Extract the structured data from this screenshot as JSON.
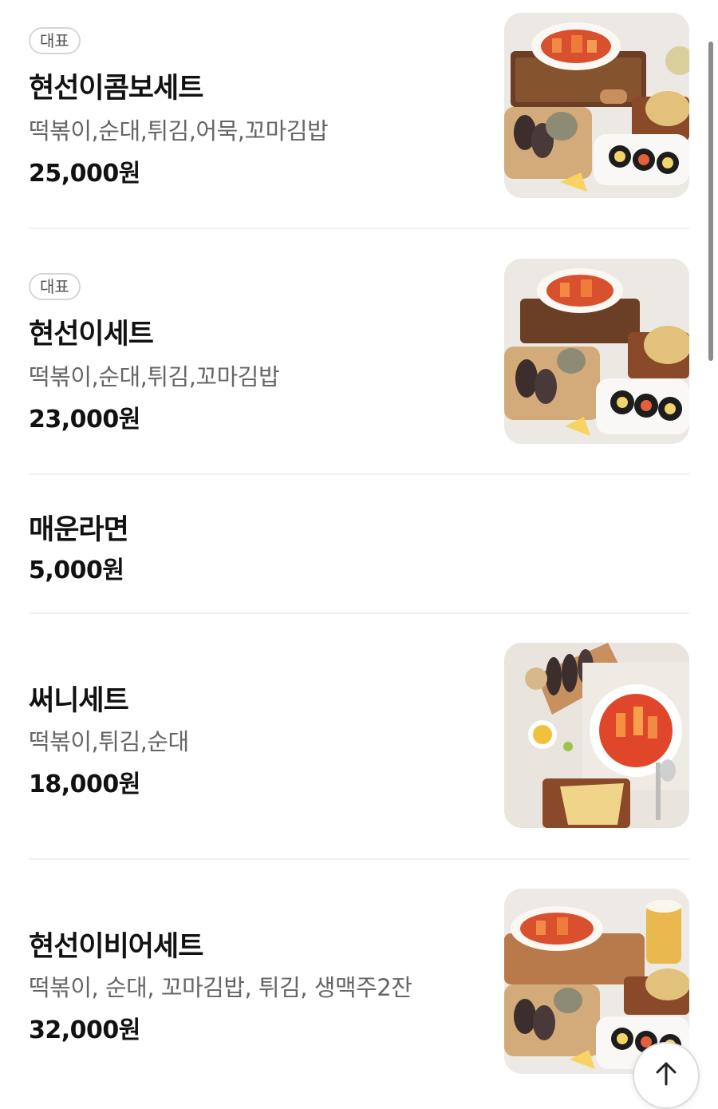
{
  "menu": {
    "items": [
      {
        "badge": "대표",
        "name": "현선이콤보세트",
        "desc": "떡볶이,순대,튀김,어묵,꼬마김밥",
        "price": "25,000원",
        "image": "combo-set-photo"
      },
      {
        "badge": "대표",
        "name": "현선이세트",
        "desc": "떡볶이,순대,튀김,꼬마김밥",
        "price": "23,000원",
        "image": "set-photo"
      },
      {
        "name": "매운라면",
        "price": "5,000원"
      },
      {
        "name": "써니세트",
        "desc": "떡볶이,튀김,순대",
        "price": "18,000원",
        "image": "sunny-set-photo"
      },
      {
        "name": "현선이비어세트",
        "desc": "떡볶이, 순대, 꼬마김밥, 튀김, 생맥주2잔",
        "price": "32,000원",
        "image": "beer-set-photo"
      }
    ]
  },
  "controls": {
    "scroll_top_icon": "arrow-up-icon"
  }
}
